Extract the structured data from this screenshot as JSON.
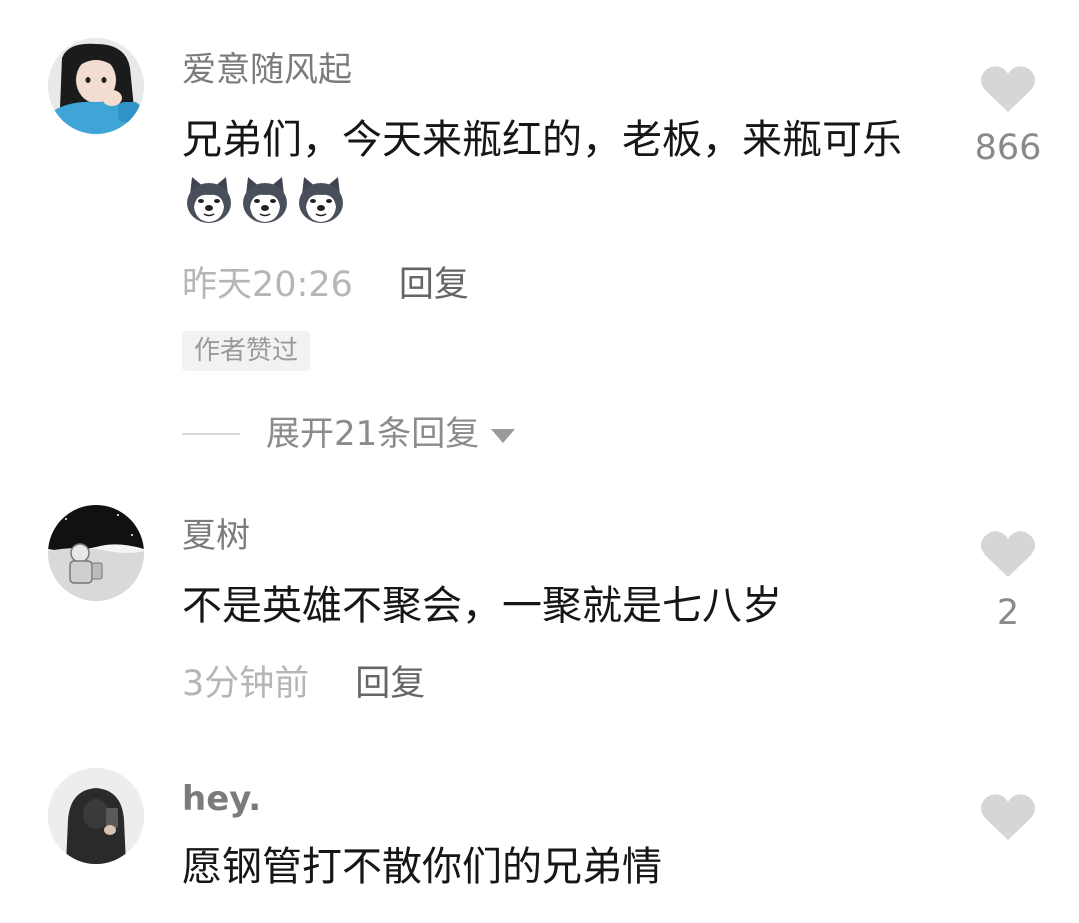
{
  "comments": [
    {
      "username": "爱意随风起",
      "text": "兄弟们，今天来瓶红的，老板，来瓶可乐",
      "emoji_count": 3,
      "emoji_icon": "husky-dog-emoji",
      "time": "昨天20:26",
      "reply_label": "回复",
      "badge": "作者赞过",
      "expand_label": "展开21条回复",
      "likes": "866"
    },
    {
      "username": "夏树",
      "text": "不是英雄不聚会，一聚就是七八岁",
      "time": "3分钟前",
      "reply_label": "回复",
      "likes": "2"
    },
    {
      "username": "hey.",
      "text": "愿钢管打不散你们的兄弟情",
      "likes": ""
    }
  ],
  "icons": {
    "like": "heart-icon",
    "expand": "caret-down-icon"
  },
  "colors": {
    "like_heart": "#d6d6d6",
    "username": "#7b7b7b",
    "body_text": "#161616",
    "time": "#b6b6b6"
  }
}
